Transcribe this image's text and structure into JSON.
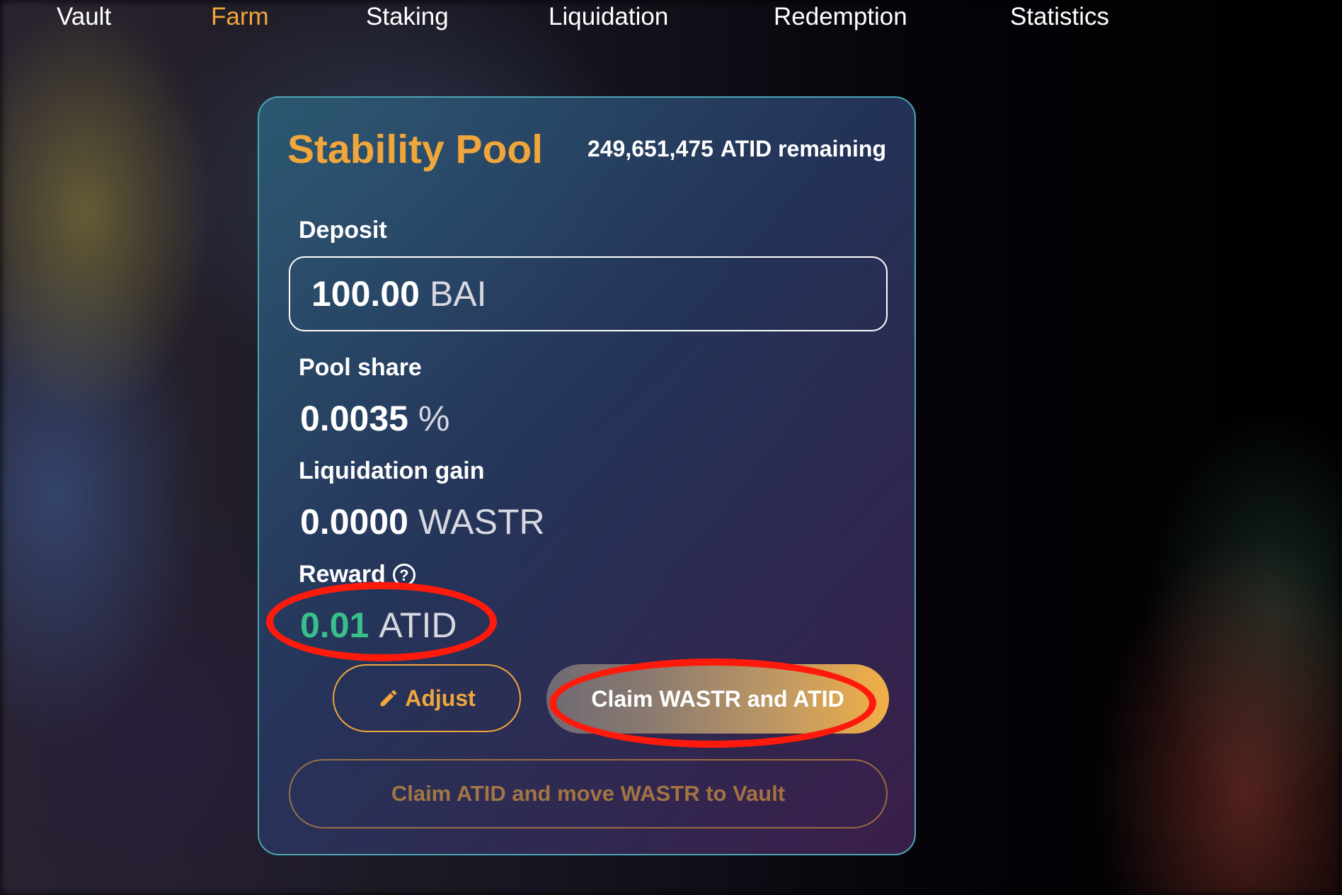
{
  "nav": {
    "items": [
      {
        "label": "Vault"
      },
      {
        "label": "Farm",
        "active": true
      },
      {
        "label": "Staking"
      },
      {
        "label": "Liquidation"
      },
      {
        "label": "Redemption"
      },
      {
        "label": "Statistics"
      }
    ]
  },
  "card": {
    "title": "Stability Pool",
    "remaining_amount": "249,651,475",
    "remaining_suffix": "ATID remaining",
    "deposit": {
      "label": "Deposit",
      "value": "100.00",
      "unit": "BAI"
    },
    "pool_share": {
      "label": "Pool share",
      "value": "0.0035",
      "unit": "%"
    },
    "liquidation_gain": {
      "label": "Liquidation gain",
      "value": "0.0000",
      "unit": "WASTR"
    },
    "reward": {
      "label": "Reward",
      "value": "0.01",
      "unit": "ATID",
      "help_icon": "question-circle-icon"
    },
    "buttons": {
      "adjust": "Adjust",
      "adjust_icon": "pencil-icon",
      "claim": "Claim WASTR and ATID",
      "claim_move": "Claim ATID and move WASTR to Vault"
    }
  },
  "colors": {
    "accent": "#f0a63b",
    "reward_green": "#39c08a",
    "annotation_red": "#ff1a0c",
    "card_border": "#4aa6b3"
  }
}
